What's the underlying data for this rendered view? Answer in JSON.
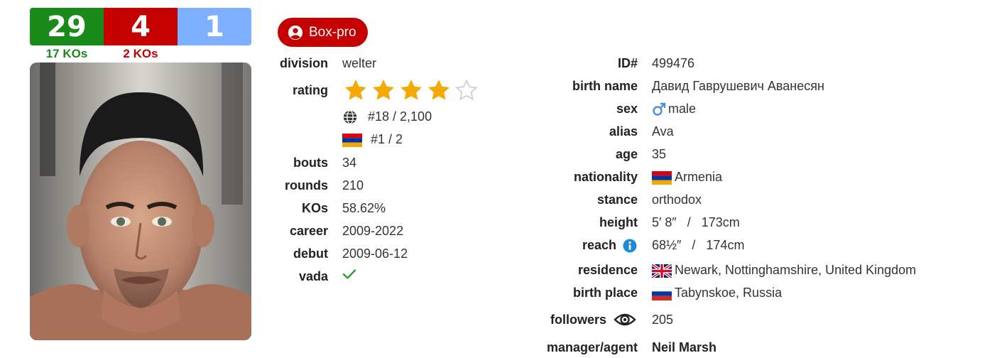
{
  "record": {
    "wins": "29",
    "losses": "4",
    "draws": "1",
    "win_kos": "17 KOs",
    "loss_kos": "2 KOs",
    "colors": {
      "win": "#1a8a1a",
      "loss": "#c40000",
      "draw": "#7fb0ff"
    }
  },
  "badge": {
    "label": "Box-pro",
    "icon": "user-circle-icon",
    "color": "#c40000"
  },
  "left": {
    "division": {
      "label": "division",
      "value": "welter"
    },
    "rating": {
      "label": "rating",
      "stars": 4,
      "max_stars": 5,
      "star_color": "#f5a800"
    },
    "world_rank": {
      "icon": "globe-icon",
      "value": "#18 / 2,100"
    },
    "national_rank": {
      "icon": "armenia-flag",
      "value": "#1 / 2"
    },
    "bouts": {
      "label": "bouts",
      "value": "34"
    },
    "rounds": {
      "label": "rounds",
      "value": "210"
    },
    "kos": {
      "label": "KOs",
      "value": "58.62%"
    },
    "career": {
      "label": "career",
      "value": "2009-2022"
    },
    "debut": {
      "label": "debut",
      "value": "2009-06-12"
    },
    "vada": {
      "label": "vada",
      "icon": "check-icon"
    }
  },
  "right": {
    "id": {
      "label": "ID#",
      "value": "499476"
    },
    "birth_name": {
      "label": "birth name",
      "value": "Давид Гаврушевич Аванесян"
    },
    "sex": {
      "label": "sex",
      "icon": "male-icon",
      "value": "male"
    },
    "alias": {
      "label": "alias",
      "value": "Ava"
    },
    "age": {
      "label": "age",
      "value": "35"
    },
    "nationality": {
      "label": "nationality",
      "icon": "armenia-flag",
      "value": "Armenia"
    },
    "stance": {
      "label": "stance",
      "value": "orthodox"
    },
    "height": {
      "label": "height",
      "value": "5′ 8″   /   173cm"
    },
    "reach": {
      "label": "reach",
      "icon": "info-icon",
      "value": "68½″   /   174cm"
    },
    "residence": {
      "label": "residence",
      "icon": "uk-flag",
      "value": "Newark, Nottinghamshire, United Kingdom"
    },
    "birth_place": {
      "label": "birth place",
      "icon": "russia-flag",
      "value": "Tabynskoe, Russia"
    },
    "followers": {
      "label": "followers",
      "icon": "eye-icon",
      "value": "205"
    },
    "manager": {
      "label": "manager/agent",
      "value": "Neil Marsh"
    }
  }
}
